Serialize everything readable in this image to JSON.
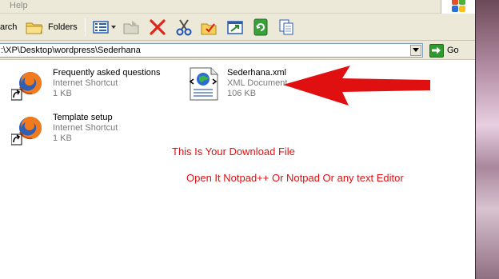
{
  "menubar": {
    "help_label": "Help"
  },
  "toolbar": {
    "search_label": "arch",
    "folders_label": "Folders"
  },
  "address": {
    "path": ":\\XP\\Desktop\\wordpress\\Sederhana",
    "go_label": "Go"
  },
  "files": [
    {
      "name": "Frequently asked questions",
      "type": "Internet Shortcut",
      "size": "1 KB",
      "icon": "firefox-shortcut-icon"
    },
    {
      "name": "Template setup",
      "type": "Internet Shortcut",
      "size": "1 KB",
      "icon": "firefox-shortcut-icon"
    },
    {
      "name": "Sederhana.xml",
      "type": "XML Document",
      "size": "106 KB",
      "icon": "xml-document-icon"
    }
  ],
  "annotations": {
    "line1": "This Is Your Download File",
    "line2": "Open It Notpad++ Or Notpad Or any text Editor",
    "color": "#e01010"
  }
}
